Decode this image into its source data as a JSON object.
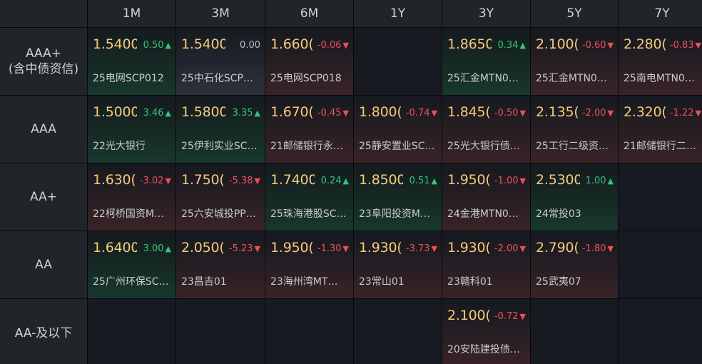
{
  "columns": [
    "1M",
    "3M",
    "6M",
    "1Y",
    "3Y",
    "5Y",
    "7Y"
  ],
  "colors": {
    "up": "#35c47a",
    "down": "#f0505a",
    "rate": "#f6c97a"
  },
  "icons": {
    "up": "triangle-up-icon",
    "down": "triangle-down-icon"
  },
  "rows": [
    {
      "label": [
        "AAA+",
        "(含中债资信)"
      ],
      "cells": [
        {
          "rate": "1.5400",
          "change": "0.50",
          "dir": "up",
          "bond": "25电网SCP012"
        },
        {
          "rate": "1.5400",
          "change": "0.00",
          "dir": "flat",
          "bond": "25中石化SCP…"
        },
        {
          "rate": "1.660(",
          "change": "-0.06",
          "dir": "down",
          "bond": "25电网SCP018"
        },
        null,
        {
          "rate": "1.8650",
          "change": "0.34",
          "dir": "up",
          "bond": "25汇金MTN0…"
        },
        {
          "rate": "2.100(",
          "change": "-0.60",
          "dir": "down",
          "bond": "25汇金MTN0…"
        },
        {
          "rate": "2.280(",
          "change": "-0.83",
          "dir": "down",
          "bond": "25南电MTN0…"
        }
      ]
    },
    {
      "label": [
        "AAA"
      ],
      "cells": [
        {
          "rate": "1.5000",
          "change": "3.46",
          "dir": "up",
          "bond": "22光大银行"
        },
        {
          "rate": "1.5800",
          "change": "3.35",
          "dir": "up",
          "bond": "25伊利实业SC…"
        },
        {
          "rate": "1.670(",
          "change": "-0.45",
          "dir": "down",
          "bond": "21邮储银行永…"
        },
        {
          "rate": "1.800(",
          "change": "-0.74",
          "dir": "down",
          "bond": "25静安置业SC…"
        },
        {
          "rate": "1.845(",
          "change": "-0.50",
          "dir": "down",
          "bond": "25光大银行债…"
        },
        {
          "rate": "2.135(",
          "change": "-2.00",
          "dir": "down",
          "bond": "25工行二级资…"
        },
        {
          "rate": "2.320(",
          "change": "-1.22",
          "dir": "down",
          "bond": "21邮储银行二…"
        }
      ]
    },
    {
      "label": [
        "AA+"
      ],
      "cells": [
        {
          "rate": "1.630(",
          "change": "-3.02",
          "dir": "down",
          "bond": "22柯桥国资M…"
        },
        {
          "rate": "1.750(",
          "change": "-5.38",
          "dir": "down",
          "bond": "25六安城投PP…"
        },
        {
          "rate": "1.7400",
          "change": "0.24",
          "dir": "up",
          "bond": "25珠海港股SC…"
        },
        {
          "rate": "1.8500",
          "change": "0.51",
          "dir": "up",
          "bond": "23阜阳投资M…"
        },
        {
          "rate": "1.950(",
          "change": "-1.00",
          "dir": "down",
          "bond": "24金港MTN0…"
        },
        {
          "rate": "2.5300",
          "change": "1.00",
          "dir": "up",
          "bond": "24常投03"
        },
        null
      ]
    },
    {
      "label": [
        "AA"
      ],
      "cells": [
        {
          "rate": "1.6400",
          "change": "3.00",
          "dir": "up",
          "bond": "25广州环保SC…"
        },
        {
          "rate": "2.050(",
          "change": "-5.23",
          "dir": "down",
          "bond": "23昌吉01"
        },
        {
          "rate": "1.950(",
          "change": "-1.30",
          "dir": "down",
          "bond": "23海州湾MT…"
        },
        {
          "rate": "1.930(",
          "change": "-3.73",
          "dir": "down",
          "bond": "23常山01"
        },
        {
          "rate": "1.930(",
          "change": "-2.00",
          "dir": "down",
          "bond": "23赣科01"
        },
        {
          "rate": "2.790(",
          "change": "-1.80",
          "dir": "down",
          "bond": "25武夷07"
        },
        null
      ]
    },
    {
      "label": [
        "AA-及以下"
      ],
      "cells": [
        null,
        null,
        null,
        null,
        {
          "rate": "2.100(",
          "change": "-0.72",
          "dir": "down",
          "bond": "20安陆建投债…"
        },
        null,
        null
      ]
    }
  ]
}
